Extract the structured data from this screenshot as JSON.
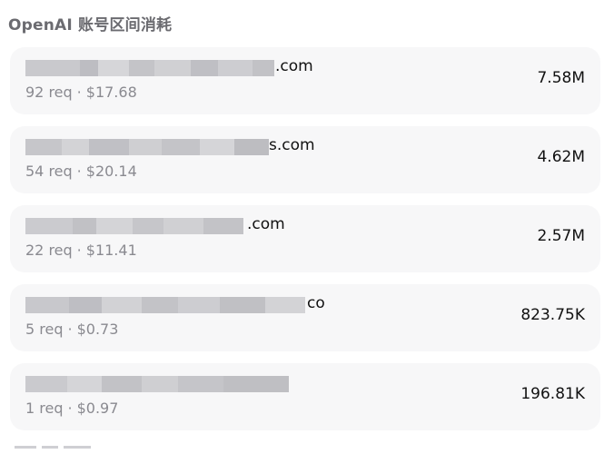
{
  "section": {
    "title": "OpenAI 账号区间消耗"
  },
  "accounts": [
    {
      "email_suffix": ".com",
      "requests": "92 req",
      "cost": "$17.68",
      "tokens": "7.58M"
    },
    {
      "email_suffix": "s.com",
      "requests": "54 req",
      "cost": "$20.14",
      "tokens": "4.62M"
    },
    {
      "email_suffix": ".com",
      "requests": "22 req",
      "cost": "$11.41",
      "tokens": "2.57M"
    },
    {
      "email_suffix": "co",
      "requests": "5 req",
      "cost": "$0.73",
      "tokens": "823.75K"
    },
    {
      "email_suffix": "",
      "requests": "1 req",
      "cost": "$0.97",
      "tokens": "196.81K"
    }
  ],
  "separator": "·",
  "colors": {
    "card_bg": "#f7f7f8",
    "title": "#6b6b70",
    "meta": "#8a8a90",
    "text": "#111111",
    "redaction": "#c4c4c8"
  }
}
